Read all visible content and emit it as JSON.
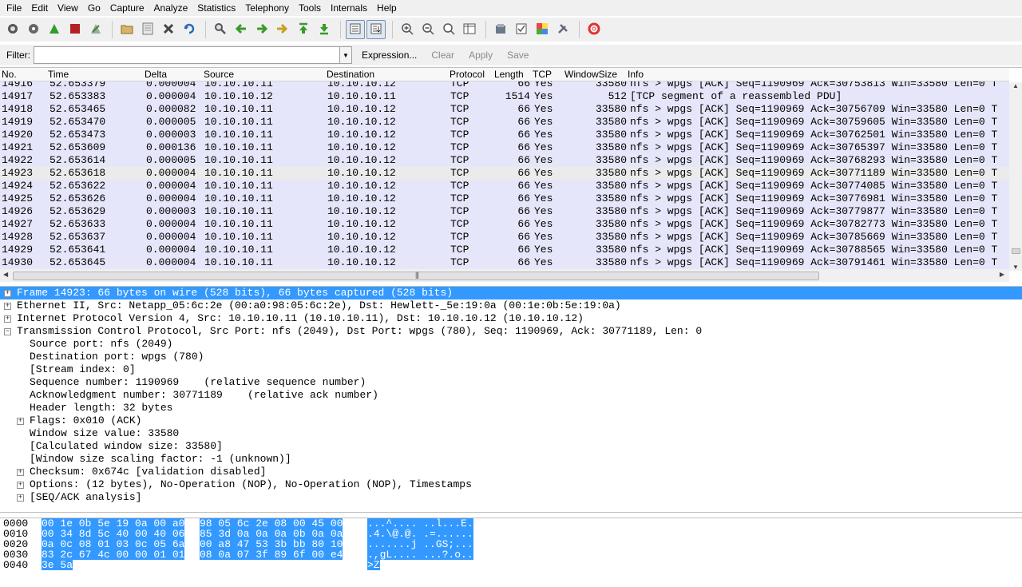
{
  "menu": [
    "File",
    "Edit",
    "View",
    "Go",
    "Capture",
    "Analyze",
    "Statistics",
    "Telephony",
    "Tools",
    "Internals",
    "Help"
  ],
  "toolbar": [
    {
      "name": "list-interfaces-icon"
    },
    {
      "name": "capture-options-icon"
    },
    {
      "name": "start-capture-icon"
    },
    {
      "name": "stop-capture-icon"
    },
    {
      "name": "restart-capture-icon"
    },
    {
      "sep": true
    },
    {
      "name": "open-file-icon"
    },
    {
      "name": "save-file-icon"
    },
    {
      "name": "close-file-icon"
    },
    {
      "name": "reload-icon"
    },
    {
      "sep": true
    },
    {
      "name": "find-packet-icon"
    },
    {
      "name": "go-back-icon"
    },
    {
      "name": "go-forward-icon"
    },
    {
      "name": "go-to-packet-icon"
    },
    {
      "name": "go-first-icon"
    },
    {
      "name": "go-last-icon"
    },
    {
      "sep": true
    },
    {
      "name": "colorize-icon",
      "pressed": true
    },
    {
      "name": "auto-scroll-icon",
      "pressed": true
    },
    {
      "sep": true
    },
    {
      "name": "zoom-in-icon"
    },
    {
      "name": "zoom-out-icon"
    },
    {
      "name": "normal-size-icon"
    },
    {
      "name": "resize-columns-icon"
    },
    {
      "sep": true
    },
    {
      "name": "capture-filters-icon"
    },
    {
      "name": "display-filters-icon"
    },
    {
      "name": "coloring-rules-icon"
    },
    {
      "name": "preferences-icon"
    },
    {
      "sep": true
    },
    {
      "name": "help-icon"
    }
  ],
  "filter": {
    "label": "Filter:",
    "value": "",
    "actions": {
      "expression": "Expression...",
      "clear": "Clear",
      "apply": "Apply",
      "save": "Save"
    }
  },
  "packet_list": {
    "columns": [
      "No.",
      "Time",
      "Delta",
      "Source",
      "Destination",
      "Protocol",
      "Length",
      "TCP",
      "WindowSize",
      "Info"
    ],
    "rows": [
      {
        "no": "14916",
        "time": "52.653379",
        "delta": "0.000004",
        "source": "10.10.10.11",
        "destination": "10.10.10.12",
        "protocol": "TCP",
        "length": "66",
        "tcp": "Yes",
        "window": "33580",
        "info": "nfs > wpgs [ACK] Seq=1190969 Ack=30753813 Win=33580 Len=0 T"
      },
      {
        "no": "14917",
        "time": "52.653383",
        "delta": "0.000004",
        "source": "10.10.10.12",
        "destination": "10.10.10.11",
        "protocol": "TCP",
        "length": "1514",
        "tcp": "Yes",
        "window": "512",
        "info": "[TCP segment of a reassembled PDU]"
      },
      {
        "no": "14918",
        "time": "52.653465",
        "delta": "0.000082",
        "source": "10.10.10.11",
        "destination": "10.10.10.12",
        "protocol": "TCP",
        "length": "66",
        "tcp": "Yes",
        "window": "33580",
        "info": "nfs > wpgs [ACK] Seq=1190969 Ack=30756709 Win=33580 Len=0 T"
      },
      {
        "no": "14919",
        "time": "52.653470",
        "delta": "0.000005",
        "source": "10.10.10.11",
        "destination": "10.10.10.12",
        "protocol": "TCP",
        "length": "66",
        "tcp": "Yes",
        "window": "33580",
        "info": "nfs > wpgs [ACK] Seq=1190969 Ack=30759605 Win=33580 Len=0 T"
      },
      {
        "no": "14920",
        "time": "52.653473",
        "delta": "0.000003",
        "source": "10.10.10.11",
        "destination": "10.10.10.12",
        "protocol": "TCP",
        "length": "66",
        "tcp": "Yes",
        "window": "33580",
        "info": "nfs > wpgs [ACK] Seq=1190969 Ack=30762501 Win=33580 Len=0 T"
      },
      {
        "no": "14921",
        "time": "52.653609",
        "delta": "0.000136",
        "source": "10.10.10.11",
        "destination": "10.10.10.12",
        "protocol": "TCP",
        "length": "66",
        "tcp": "Yes",
        "window": "33580",
        "info": "nfs > wpgs [ACK] Seq=1190969 Ack=30765397 Win=33580 Len=0 T"
      },
      {
        "no": "14922",
        "time": "52.653614",
        "delta": "0.000005",
        "source": "10.10.10.11",
        "destination": "10.10.10.12",
        "protocol": "TCP",
        "length": "66",
        "tcp": "Yes",
        "window": "33580",
        "info": "nfs > wpgs [ACK] Seq=1190969 Ack=30768293 Win=33580 Len=0 T"
      },
      {
        "no": "14923",
        "time": "52.653618",
        "delta": "0.000004",
        "source": "10.10.10.11",
        "destination": "10.10.10.12",
        "protocol": "TCP",
        "length": "66",
        "tcp": "Yes",
        "window": "33580",
        "info": "nfs > wpgs [ACK] Seq=1190969 Ack=30771189 Win=33580 Len=0 T",
        "selected": true
      },
      {
        "no": "14924",
        "time": "52.653622",
        "delta": "0.000004",
        "source": "10.10.10.11",
        "destination": "10.10.10.12",
        "protocol": "TCP",
        "length": "66",
        "tcp": "Yes",
        "window": "33580",
        "info": "nfs > wpgs [ACK] Seq=1190969 Ack=30774085 Win=33580 Len=0 T"
      },
      {
        "no": "14925",
        "time": "52.653626",
        "delta": "0.000004",
        "source": "10.10.10.11",
        "destination": "10.10.10.12",
        "protocol": "TCP",
        "length": "66",
        "tcp": "Yes",
        "window": "33580",
        "info": "nfs > wpgs [ACK] Seq=1190969 Ack=30776981 Win=33580 Len=0 T"
      },
      {
        "no": "14926",
        "time": "52.653629",
        "delta": "0.000003",
        "source": "10.10.10.11",
        "destination": "10.10.10.12",
        "protocol": "TCP",
        "length": "66",
        "tcp": "Yes",
        "window": "33580",
        "info": "nfs > wpgs [ACK] Seq=1190969 Ack=30779877 Win=33580 Len=0 T"
      },
      {
        "no": "14927",
        "time": "52.653633",
        "delta": "0.000004",
        "source": "10.10.10.11",
        "destination": "10.10.10.12",
        "protocol": "TCP",
        "length": "66",
        "tcp": "Yes",
        "window": "33580",
        "info": "nfs > wpgs [ACK] Seq=1190969 Ack=30782773 Win=33580 Len=0 T"
      },
      {
        "no": "14928",
        "time": "52.653637",
        "delta": "0.000004",
        "source": "10.10.10.11",
        "destination": "10.10.10.12",
        "protocol": "TCP",
        "length": "66",
        "tcp": "Yes",
        "window": "33580",
        "info": "nfs > wpgs [ACK] Seq=1190969 Ack=30785669 Win=33580 Len=0 T"
      },
      {
        "no": "14929",
        "time": "52.653641",
        "delta": "0.000004",
        "source": "10.10.10.11",
        "destination": "10.10.10.12",
        "protocol": "TCP",
        "length": "66",
        "tcp": "Yes",
        "window": "33580",
        "info": "nfs > wpgs [ACK] Seq=1190969 Ack=30788565 Win=33580 Len=0 T"
      },
      {
        "no": "14930",
        "time": "52.653645",
        "delta": "0.000004",
        "source": "10.10.10.11",
        "destination": "10.10.10.12",
        "protocol": "TCP",
        "length": "66",
        "tcp": "Yes",
        "window": "33580",
        "info": "nfs > wpgs [ACK] Seq=1190969 Ack=30791461 Win=33580 Len=0 T"
      }
    ]
  },
  "details": [
    {
      "level": 0,
      "expander": "plus",
      "selected": true,
      "text": "Frame 14923: 66 bytes on wire (528 bits), 66 bytes captured (528 bits)"
    },
    {
      "level": 0,
      "expander": "plus",
      "text": "Ethernet II, Src: Netapp_05:6c:2e (00:a0:98:05:6c:2e), Dst: Hewlett-_5e:19:0a (00:1e:0b:5e:19:0a)"
    },
    {
      "level": 0,
      "expander": "plus",
      "text": "Internet Protocol Version 4, Src: 10.10.10.11 (10.10.10.11), Dst: 10.10.10.12 (10.10.10.12)"
    },
    {
      "level": 0,
      "expander": "minus",
      "text": "Transmission Control Protocol, Src Port: nfs (2049), Dst Port: wpgs (780), Seq: 1190969, Ack: 30771189, Len: 0"
    },
    {
      "level": 1,
      "text": "Source port: nfs (2049)"
    },
    {
      "level": 1,
      "text": "Destination port: wpgs (780)"
    },
    {
      "level": 1,
      "text": "[Stream index: 0]"
    },
    {
      "level": 1,
      "text": "Sequence number: 1190969    (relative sequence number)"
    },
    {
      "level": 1,
      "text": "Acknowledgment number: 30771189    (relative ack number)"
    },
    {
      "level": 1,
      "text": "Header length: 32 bytes"
    },
    {
      "level": 1,
      "expander": "plus",
      "text": "Flags: 0x010 (ACK)"
    },
    {
      "level": 1,
      "text": "Window size value: 33580"
    },
    {
      "level": 1,
      "text": "[Calculated window size: 33580]"
    },
    {
      "level": 1,
      "text": "[Window size scaling factor: -1 (unknown)]"
    },
    {
      "level": 1,
      "expander": "plus",
      "text": "Checksum: 0x674c [validation disabled]"
    },
    {
      "level": 1,
      "expander": "plus",
      "text": "Options: (12 bytes), No-Operation (NOP), No-Operation (NOP), Timestamps"
    },
    {
      "level": 1,
      "expander": "plus",
      "text": "[SEQ/ACK analysis]"
    }
  ],
  "bytes": [
    {
      "offset": "0000",
      "hex1": "00 1e 0b 5e 19 0a 00 a0",
      "hex2": "98 05 6c 2e 08 00 45 00",
      "ascii": "...^.... ..l...E."
    },
    {
      "offset": "0010",
      "hex1": "00 34 8d 5c 40 00 40 06",
      "hex2": "85 3d 0a 0a 0a 0b 0a 0a",
      "ascii": ".4.\\@.@. .=......"
    },
    {
      "offset": "0020",
      "hex1": "0a 0c 08 01 03 0c 05 6a",
      "hex2": "00 a8 47 53 3b bb 80 10",
      "ascii": ".......j ..GS;..."
    },
    {
      "offset": "0030",
      "hex1": "83 2c 67 4c 00 00 01 01",
      "hex2": "08 0a 07 3f 89 6f 00 e4",
      "ascii": ".,gL.... ...?.o.."
    },
    {
      "offset": "0040",
      "hex1": "3e 5a",
      "hex2": "",
      "ascii": ">Z"
    }
  ]
}
